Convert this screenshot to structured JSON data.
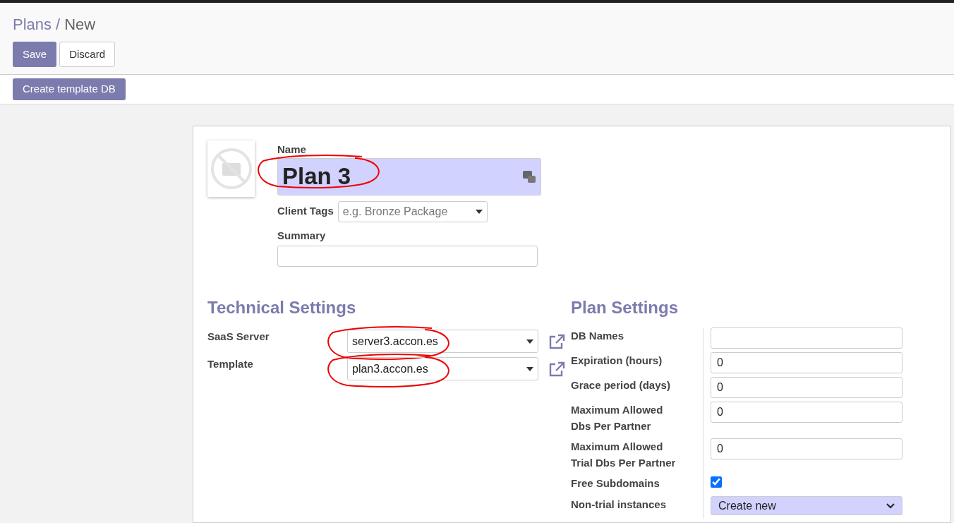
{
  "breadcrumb": {
    "items": [
      "Plans",
      "New"
    ],
    "separator": "/"
  },
  "header_buttons": [
    {
      "label": "Save",
      "kind": "primary"
    },
    {
      "label": "Discard",
      "kind": "secondary"
    }
  ],
  "action_buttons": [
    "Create template DB"
  ],
  "form": {
    "name": {
      "label": "Name",
      "value": "Plan 3",
      "annotated": true
    },
    "client_tags": {
      "label": "Client Tags",
      "placeholder": "e.g. Bronze Package"
    },
    "summary": {
      "label": "Summary"
    },
    "technical": {
      "title": "Technical Settings",
      "fields": [
        {
          "label": "SaaS Server",
          "value": "server3.accon.es",
          "annotated": true
        },
        {
          "label": "Template",
          "value": "plan3.accon.es",
          "annotated": true
        }
      ]
    },
    "plan": {
      "title": "Plan Settings",
      "fields": [
        {
          "kind": "text",
          "label": "DB Names"
        },
        {
          "kind": "text",
          "label": "Expiration (hours)",
          "value": "0"
        },
        {
          "kind": "text",
          "label": "Grace period (days)",
          "value": "0"
        },
        {
          "kind": "text",
          "label": "Maximum Allowed Dbs Per Partner",
          "value": "0"
        },
        {
          "kind": "text",
          "label": "Maximum Allowed Trial Dbs Per Partner",
          "value": "0"
        },
        {
          "kind": "checkbox",
          "label": "Free Subdomains",
          "checked": true
        },
        {
          "kind": "select",
          "label": "Non-trial instances",
          "value": "Create new"
        }
      ]
    }
  }
}
